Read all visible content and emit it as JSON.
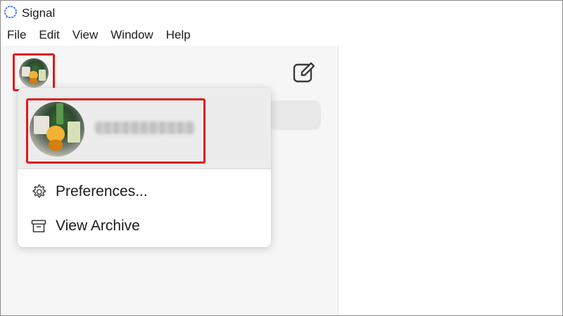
{
  "app": {
    "title": "Signal",
    "icon": "signal-logo-icon"
  },
  "menubar": {
    "items": [
      {
        "label": "File"
      },
      {
        "label": "Edit"
      },
      {
        "label": "View"
      },
      {
        "label": "Window"
      },
      {
        "label": "Help"
      }
    ]
  },
  "header": {
    "avatar": "profile-avatar",
    "compose_icon": "compose-icon"
  },
  "profile_menu": {
    "profile_name": "",
    "items": [
      {
        "label": "Preferences...",
        "icon": "gear-icon"
      },
      {
        "label": "View Archive",
        "icon": "archive-icon"
      }
    ]
  },
  "colors": {
    "highlight": "#e01818",
    "sidebar_bg": "#f6f6f6",
    "menu_profile_bg": "#ececec"
  }
}
